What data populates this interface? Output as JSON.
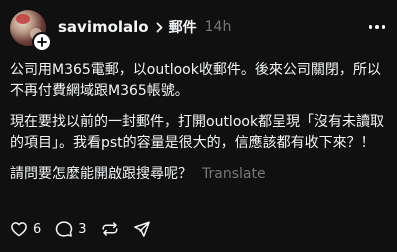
{
  "post": {
    "username": "savimolalo",
    "topic": "郵件",
    "timestamp": "14h",
    "paragraphs": [
      "公司用M365電郵，以outlook收郵件。後來公司關閉，所以不再付費網域跟M365帳號。",
      "現在要找以前的一封郵件，打開outlook都呈現「沒有未讀取的項目」。我看pst的容量是很大的，信應該都有收下來？！",
      "請問要怎麼能開啟跟搜尋呢？"
    ],
    "translate_label": "Translate",
    "icons": [
      "avatar",
      "follow-plus-icon",
      "chevron-right-icon",
      "more-icon",
      "heart-icon",
      "comment-icon",
      "repost-icon",
      "share-icon"
    ]
  },
  "actions": {
    "likes": "6",
    "comments": "3",
    "reposts": "",
    "shares": ""
  },
  "colors": {
    "background": "#101010",
    "text": "#f3f5f7",
    "muted": "#777777"
  }
}
